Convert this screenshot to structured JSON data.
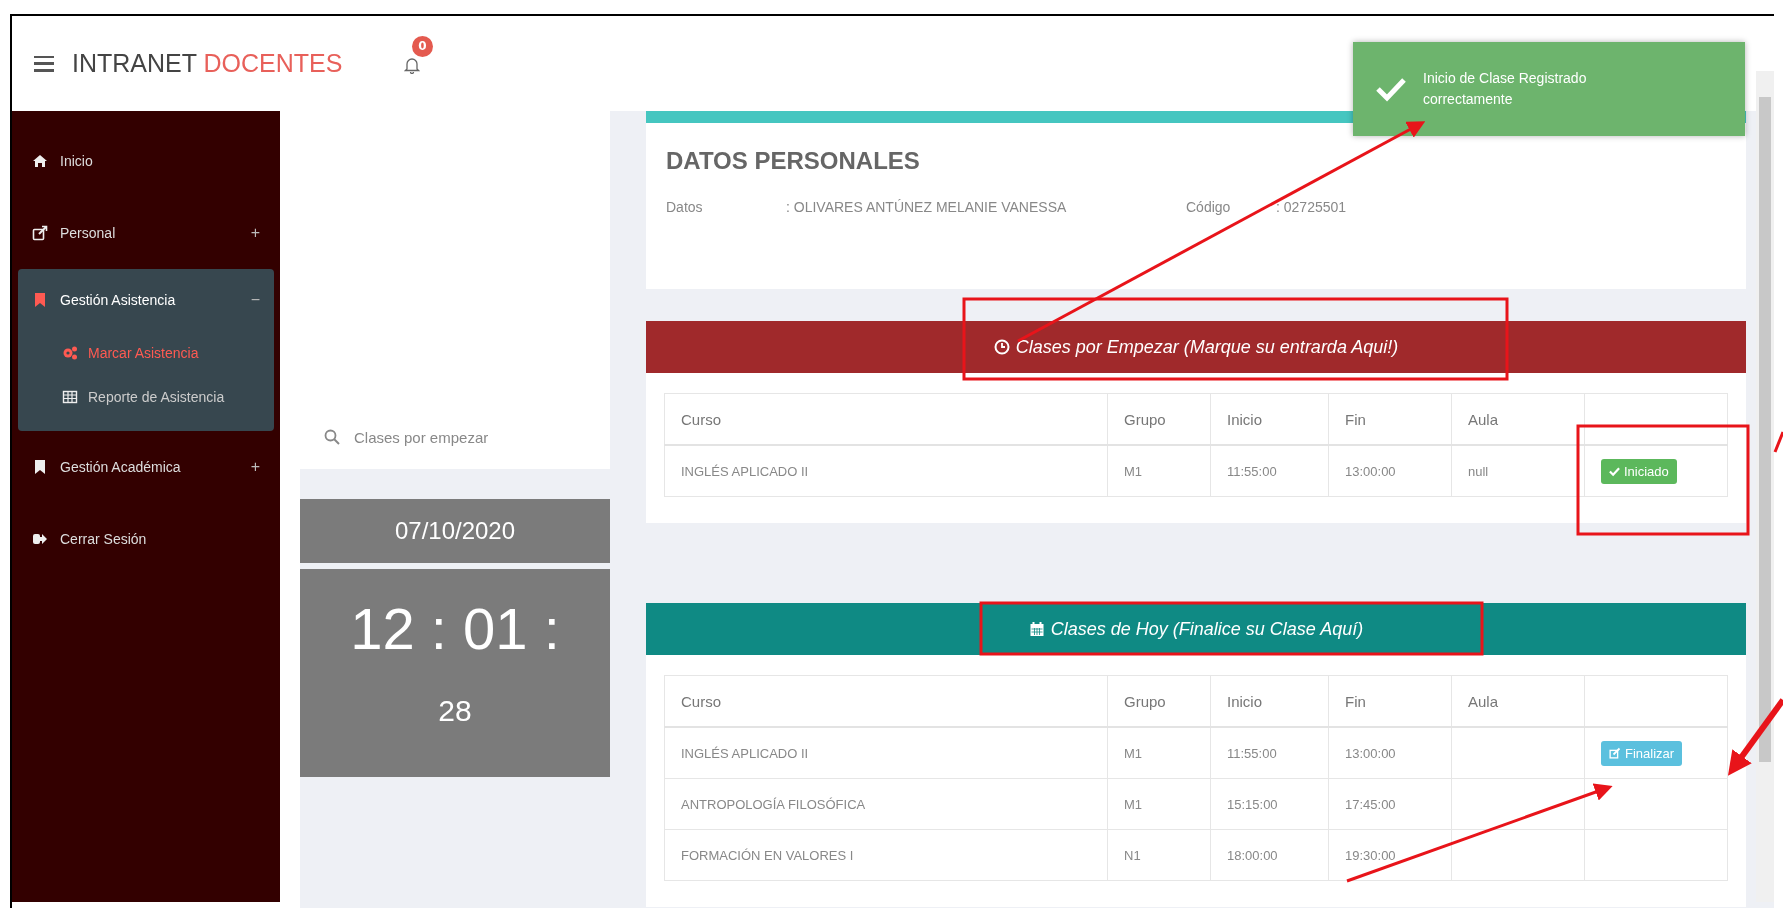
{
  "topbar": {
    "brand": "INTRANET",
    "brand_accent": "DOCENTES",
    "notification_count": "0"
  },
  "sidebar": {
    "items": [
      {
        "label": "Inicio",
        "expanded": false
      },
      {
        "label": "Personal",
        "toggle": "+",
        "expanded": false
      },
      {
        "label": "Gestión Asistencia",
        "toggle": "−",
        "expanded": true,
        "children": [
          {
            "label": "Marcar Asistencia",
            "selected": true
          },
          {
            "label": "Reporte de Asistencia",
            "selected": false
          }
        ]
      },
      {
        "label": "Gestión Académica",
        "toggle": "+",
        "expanded": false
      },
      {
        "label": "Cerrar Sesión",
        "expanded": false
      }
    ]
  },
  "search": {
    "placeholder": "Clases por empezar"
  },
  "clock": {
    "date": "07/10/2020",
    "time": "12 : 01 :",
    "seconds": "28"
  },
  "personal": {
    "title": "DATOS PERSONALES",
    "fields": [
      {
        "label": "Datos",
        "value": ": OLIVARES ANTÚNEZ MELANIE VANESSA"
      },
      {
        "label": "Código",
        "value": ": 02725501"
      }
    ]
  },
  "panels": [
    {
      "title": "Clases por Empezar (Marque su entrarda Aqui!)",
      "color": "#a0292b",
      "columns": [
        "Curso",
        "Grupo",
        "Inicio",
        "Fin",
        "Aula",
        ""
      ],
      "rows": [
        {
          "cells": [
            "INGLÉS APLICADO II",
            "M1",
            "11:55:00",
            "13:00:00",
            "null"
          ],
          "action": {
            "kind": "started",
            "label": "Iniciado"
          }
        }
      ]
    },
    {
      "title": "Clases de Hoy (Finalice su Clase Aquí)",
      "color": "#0f8a84",
      "columns": [
        "Curso",
        "Grupo",
        "Inicio",
        "Fin",
        "Aula",
        ""
      ],
      "rows": [
        {
          "cells": [
            "INGLÉS APLICADO II",
            "M1",
            "11:55:00",
            "13:00:00",
            ""
          ],
          "action": {
            "kind": "finish",
            "label": "Finalizar"
          }
        },
        {
          "cells": [
            "ANTROPOLOGÍA FILOSÓFICA",
            "M1",
            "15:15:00",
            "17:45:00",
            ""
          ],
          "action": null
        },
        {
          "cells": [
            "FORMACIÓN EN VALORES I",
            "N1",
            "18:00:00",
            "19:30:00",
            ""
          ],
          "action": null
        }
      ]
    }
  ],
  "toast": {
    "message": "Inicio de Clase Registrado correctamente"
  }
}
